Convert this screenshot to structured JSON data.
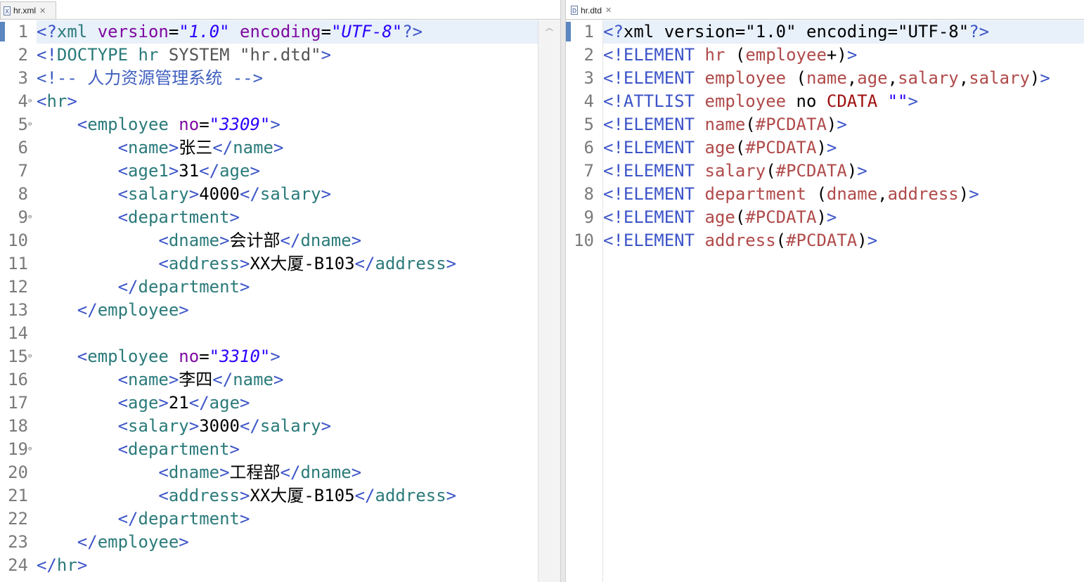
{
  "left_editor": {
    "tab_label": "hr.xml",
    "tab_icon": "xml-file-icon",
    "lines": [
      "<?xml version=\"1.0\" encoding=\"UTF-8\"?>",
      "<!DOCTYPE hr SYSTEM \"hr.dtd\">",
      "<!-- 人力资源管理系统 -->",
      "<hr>",
      "    <employee no=\"3309\">",
      "        <name>张三</name>",
      "        <age1>31</age>",
      "        <salary>4000</salary>",
      "        <department>",
      "            <dname>会计部</dname>",
      "            <address>XX大厦-B103</address>",
      "        </department>",
      "    </employee>",
      "",
      "    <employee no=\"3310\">",
      "        <name>李四</name>",
      "        <age>21</age>",
      "        <salary>3000</salary>",
      "        <department>",
      "            <dname>工程部</dname>",
      "            <address>XX大厦-B105</address>",
      "        </department>",
      "    </employee>",
      "</hr>"
    ],
    "fold_lines": [
      4,
      5,
      9,
      15,
      19
    ]
  },
  "right_editor": {
    "tab_label": "hr.dtd",
    "tab_icon": "dtd-file-icon",
    "lines": [
      "<?xml version=\"1.0\" encoding=\"UTF-8\"?>",
      "<!ELEMENT hr (employee+)>",
      "<!ELEMENT employee (name,age,salary,salary)>",
      "<!ATTLIST employee no CDATA \"\">",
      "<!ELEMENT name(#PCDATA)>",
      "<!ELEMENT age(#PCDATA)>",
      "<!ELEMENT salary(#PCDATA)>",
      "<!ELEMENT department (dname,address)>",
      "<!ELEMENT age(#PCDATA)>",
      "<!ELEMENT address(#PCDATA)>"
    ]
  },
  "colors": {
    "tag": "#2b7a7a",
    "bracket": "#3c54c8",
    "attribute": "#7f0aa0",
    "value": "#2a00ff",
    "dtd_name": "#b04a4a",
    "current_line": "#e8f0fa"
  }
}
